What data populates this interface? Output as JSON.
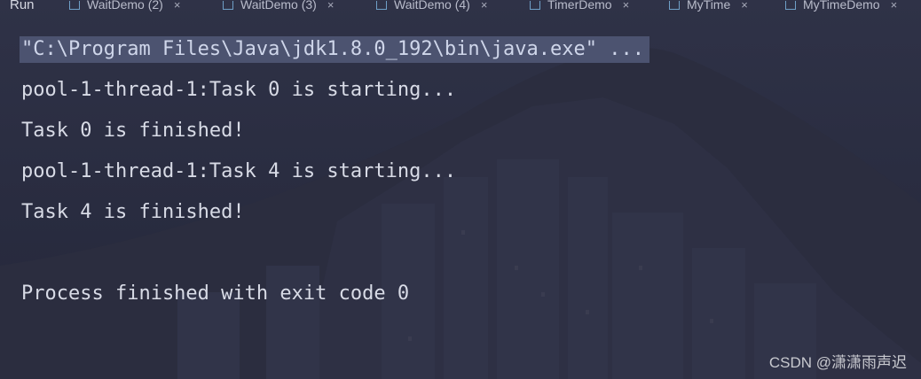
{
  "run_panel": {
    "label": "Run",
    "tabs": [
      {
        "label": "WaitDemo (2)",
        "close": "×"
      },
      {
        "label": "WaitDemo (3)",
        "close": "×"
      },
      {
        "label": "WaitDemo (4)",
        "close": "×"
      },
      {
        "label": "TimerDemo",
        "close": "×"
      },
      {
        "label": "MyTime",
        "close": "×"
      },
      {
        "label": "MyTimeDemo",
        "close": "×"
      }
    ]
  },
  "console": {
    "lines": [
      "\"C:\\Program Files\\Java\\jdk1.8.0_192\\bin\\java.exe\" ...",
      "pool-1-thread-1:Task 0 is starting...",
      "Task 0 is finished!",
      "pool-1-thread-1:Task 4 is starting...",
      "Task 4 is finished!",
      "",
      "Process finished with exit code 0"
    ]
  },
  "watermark": "CSDN @潇潇雨声迟",
  "colors": {
    "background": "#272a3a",
    "text": "#d8dbe6",
    "selection": "#4c5370"
  }
}
